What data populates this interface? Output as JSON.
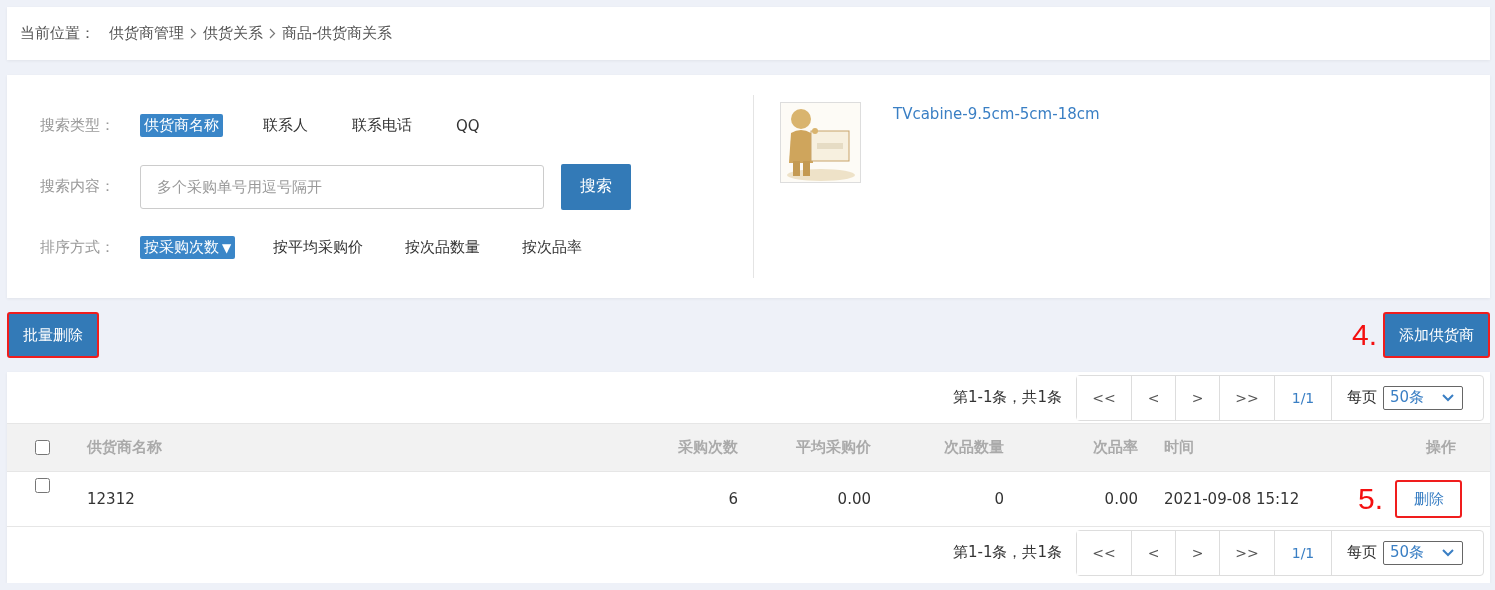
{
  "breadcrumb": {
    "label": "当前位置：",
    "items": [
      "供货商管理",
      "供货关系",
      "商品-供货商关系"
    ]
  },
  "search": {
    "type_row": {
      "label": "搜索类型：",
      "options": [
        {
          "label": "供货商名称",
          "selected": true
        },
        {
          "label": "联系人",
          "selected": false
        },
        {
          "label": "联系电话",
          "selected": false
        },
        {
          "label": "QQ",
          "selected": false
        }
      ]
    },
    "content_row": {
      "label": "搜索内容：",
      "placeholder": "多个采购单号用逗号隔开",
      "button": "搜索"
    },
    "sort_row": {
      "label": "排序方式：",
      "options": [
        {
          "label": "按采购次数",
          "selected": true,
          "sort_arrow": "▼"
        },
        {
          "label": "按平均采购价",
          "selected": false
        },
        {
          "label": "按次品数量",
          "selected": false
        },
        {
          "label": "按次品率",
          "selected": false
        }
      ]
    }
  },
  "product": {
    "name": "TVcabine-9.5cm-5cm-18cm"
  },
  "toolbar": {
    "batch_delete": {
      "label": "批量删除",
      "highlighted": true
    },
    "add_supplier": {
      "label": "添加供货商",
      "highlighted": true,
      "annotation": "4."
    }
  },
  "table": {
    "pager_top": {
      "summary": "第1-1条，共1条",
      "buttons": [
        "<<",
        "<",
        ">",
        ">>"
      ],
      "page": "1/1",
      "per_page_label": "每页",
      "per_page": "50条"
    },
    "header_checked": false,
    "columns": [
      "供货商名称",
      "采购次数",
      "平均采购价",
      "次品数量",
      "次品率",
      "时间",
      "操作"
    ],
    "rows": [
      {
        "checked": false,
        "cells": [
          "12312",
          "6",
          "0.00",
          "0",
          "0.00",
          "2021-09-08 15:12"
        ],
        "action": {
          "label": "删除",
          "highlighted": true,
          "annotation": "5."
        }
      }
    ],
    "pager_bottom": {
      "summary": "第1-1条，共1条",
      "buttons": [
        "<<",
        "<",
        ">",
        ">>"
      ],
      "page": "1/1",
      "per_page_label": "每页",
      "per_page": "50条"
    }
  }
}
